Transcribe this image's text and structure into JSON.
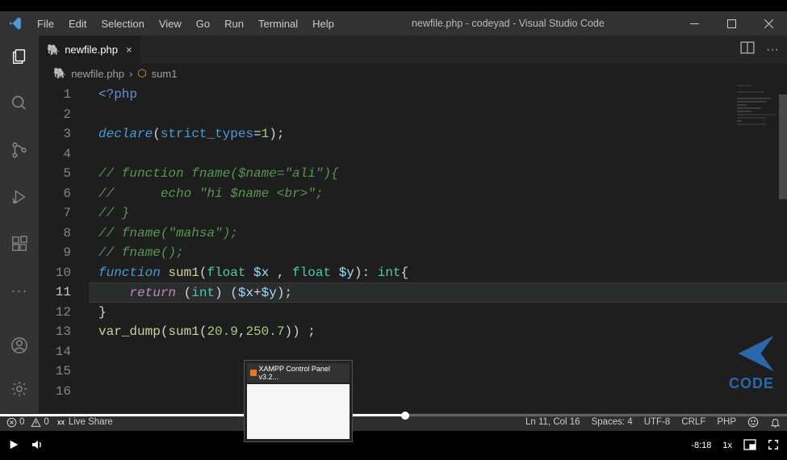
{
  "titlebar": {
    "title": "newfile.php - codeyad - Visual Studio Code",
    "menu": [
      "File",
      "Edit",
      "Selection",
      "View",
      "Go",
      "Run",
      "Terminal",
      "Help"
    ]
  },
  "tab": {
    "name": "newfile.php",
    "close": "×"
  },
  "breadcrumb": {
    "file": "newfile.php",
    "sep": "›",
    "symbol": "sum1"
  },
  "code": {
    "lines": [
      {
        "n": "1"
      },
      {
        "n": "2"
      },
      {
        "n": "3"
      },
      {
        "n": "4"
      },
      {
        "n": "5"
      },
      {
        "n": "6"
      },
      {
        "n": "7"
      },
      {
        "n": "8"
      },
      {
        "n": "9"
      },
      {
        "n": "10"
      },
      {
        "n": "11"
      },
      {
        "n": "12"
      },
      {
        "n": "13"
      },
      {
        "n": "14"
      },
      {
        "n": "15"
      },
      {
        "n": "16"
      }
    ],
    "l1_php": "<?php",
    "l3_decl": "declare",
    "l3_p1": "(",
    "l3_strict": "strict_types",
    "l3_eq": "=",
    "l3_one": "1",
    "l3_p2": ");",
    "l5": "// function fname($name=\"ali\"){",
    "l6": "//      echo \"hi $name <br>\";",
    "l7": "// }",
    "l8": "// fname(\"mahsa\");",
    "l9": "// fname();",
    "l10_fn": "function",
    "l10_name": " sum1",
    "l10_p1": "(",
    "l10_t1": "float",
    "l10_v1": " $x",
    "l10_c": " , ",
    "l10_t2": "float",
    "l10_v2": " $y",
    "l10_p2": "): ",
    "l10_t3": "int",
    "l10_br": "{",
    "l11_ret": "return",
    "l11_p1": " (",
    "l11_int": "int",
    "l11_p2": ") (",
    "l11_vx": "$x",
    "l11_plus": "+",
    "l11_vy": "$y",
    "l11_p3": ");",
    "l12": "}",
    "l13_vd": "var_dump",
    "l13_p1": "(",
    "l13_s1": "sum1",
    "l13_p2": "(",
    "l13_n1": "20.9",
    "l13_c": ",",
    "l13_n2": "250.7",
    "l13_p3": ")) ;"
  },
  "statusbar": {
    "errors": "0",
    "warnings": "0",
    "liveshare": "Live Share",
    "lncol": "Ln 11, Col 16",
    "spaces": "Spaces: 4",
    "encoding": "UTF-8",
    "eol": "CRLF",
    "lang": "PHP"
  },
  "thumbnail": {
    "title": "XAMPP Control Panel v3.2..."
  },
  "watermark": {
    "text": "CODE"
  },
  "video": {
    "time_neg": "-8:18",
    "rate": "1x"
  }
}
